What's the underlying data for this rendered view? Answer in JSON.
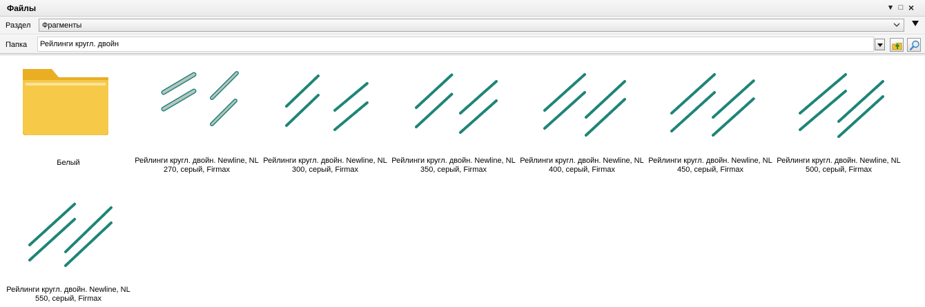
{
  "window": {
    "title": "Файлы",
    "controls": {
      "pin": "▾",
      "maximize": "□",
      "close": "×"
    }
  },
  "section": {
    "label": "Раздел",
    "value": "Фрагменты"
  },
  "folder": {
    "label": "Папка",
    "value": "Рейлинги кругл. двойн"
  },
  "items": [
    {
      "type": "folder",
      "caption": "Белый"
    },
    {
      "type": "fragment",
      "caption": "Рейлинги кругл. двойн. Newline, NL 270, серый, Firmax"
    },
    {
      "type": "fragment",
      "caption": "Рейлинги кругл. двойн. Newline, NL 300, серый, Firmax"
    },
    {
      "type": "fragment",
      "caption": "Рейлинги кругл. двойн. Newline, NL 350, серый, Firmax"
    },
    {
      "type": "fragment",
      "caption": "Рейлинги кругл. двойн. Newline, NL 400, серый, Firmax"
    },
    {
      "type": "fragment",
      "caption": "Рейлинги кругл. двойн. Newline, NL 450, серый, Firmax"
    },
    {
      "type": "fragment",
      "caption": "Рейлинги кругл. двойн. Newline, NL 500, серый, Firmax"
    },
    {
      "type": "fragment",
      "caption": "Рейлинги кругл. двойн. Newline, NL 550, серый, Firmax"
    }
  ],
  "colors": {
    "rail": "#1e8577",
    "rail_fill": "#b9c4c2",
    "folder": "#f5c542",
    "folder_dark": "#e8ad24"
  }
}
